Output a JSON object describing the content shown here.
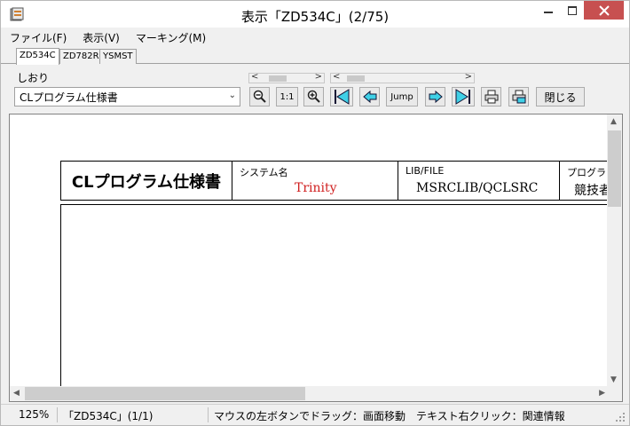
{
  "window": {
    "title": "表示「ZD534C」(2/75)"
  },
  "menu": {
    "items": [
      "ファイル(F)",
      "表示(V)",
      "マーキング(M)"
    ]
  },
  "tabs": [
    "ZD534C",
    "ZD782R",
    "YSMST"
  ],
  "toolbar": {
    "bookmark_label": "しおり",
    "bookmark_value": "CLプログラム仕様書",
    "zoom_reset_label": "1:1",
    "jump_label": "Jump",
    "close_label": "閉じる"
  },
  "document": {
    "title": "CLプログラム仕様書",
    "system_label": "システム名",
    "system_value": "Trinity",
    "libfile_label": "LIB/FILE",
    "libfile_value": "MSRCLIB/QCLSRC",
    "program_label": "プログラ",
    "program_value": "競技者"
  },
  "status": {
    "zoom": "125%",
    "page": "「ZD534C」(1/1)",
    "hint": "マウスの左ボタンでドラッグ：画面移動　テキスト右クリック：関連情報"
  },
  "colors": {
    "accent_red": "#d02020",
    "close_button": "#c75050",
    "nav_cyan": "#3fd0e6"
  }
}
